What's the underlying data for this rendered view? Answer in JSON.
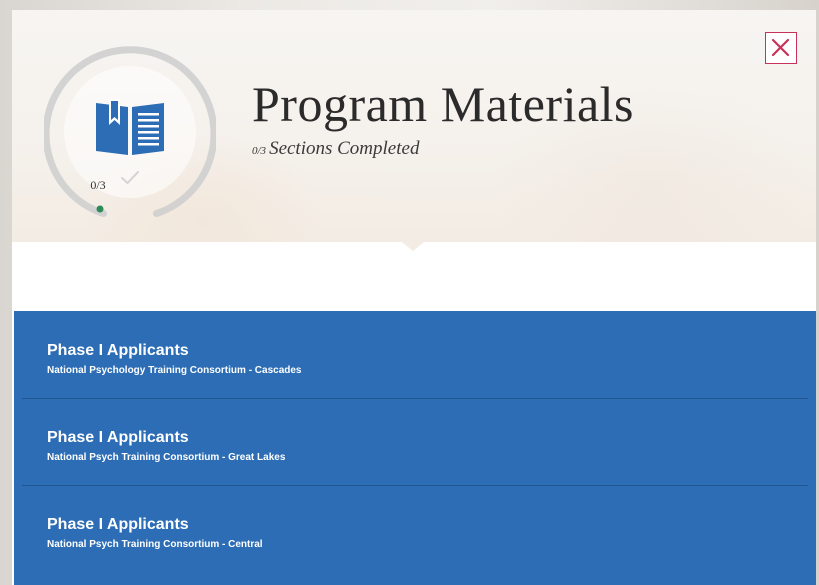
{
  "modal": {
    "title": "Program Materials",
    "progress": {
      "completed": 0,
      "total": 3,
      "count_label": "0/3",
      "ring_label": "0/3",
      "subtitle_text": "Sections Completed"
    },
    "icons": {
      "main": "open-book-icon",
      "status": "check-icon",
      "close": "close-icon"
    },
    "colors": {
      "accent_blue": "#2c6db5",
      "close_red": "#c8325a",
      "progress_dot": "#2e8b57"
    }
  },
  "sections": [
    {
      "title": "Phase I Applicants",
      "subtitle": "National Psychology Training Consortium - Cascades"
    },
    {
      "title": "Phase I Applicants",
      "subtitle": "National Psych Training Consortium - Great Lakes"
    },
    {
      "title": "Phase I Applicants",
      "subtitle": "National Psych Training Consortium - Central"
    }
  ]
}
